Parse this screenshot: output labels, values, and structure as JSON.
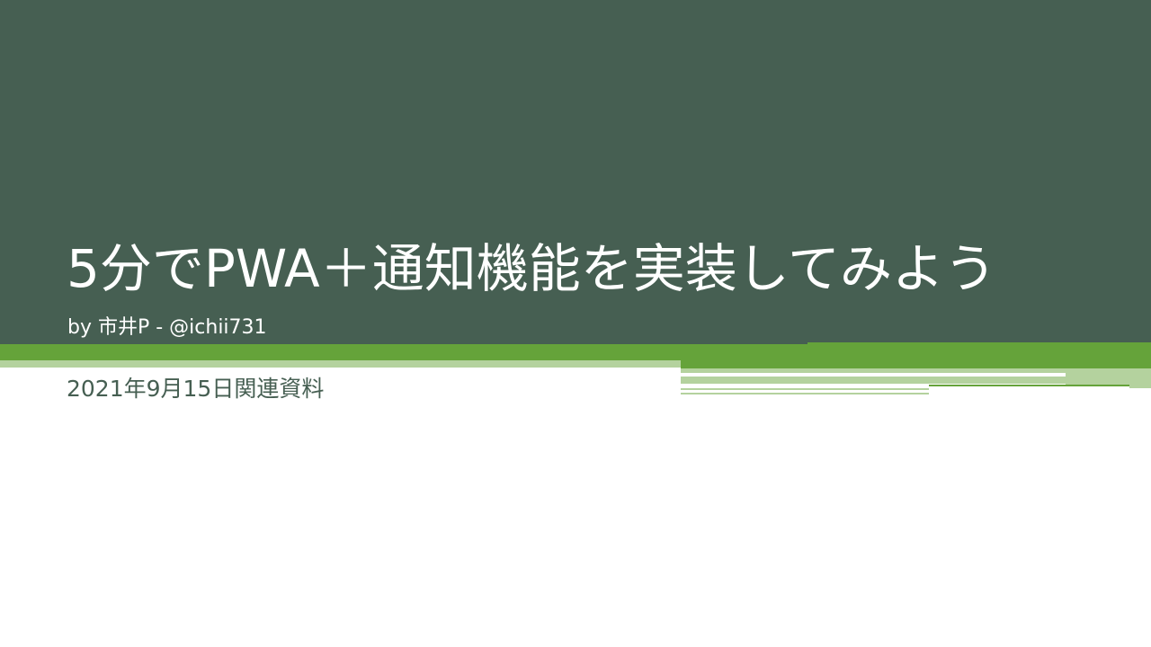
{
  "slide": {
    "title": "5分でPWA＋通知機能を実装してみよう",
    "byline": "by 市井P - @ichii731",
    "subtitle": "2021年9月15日関連資料"
  },
  "colors": {
    "band": "#465f52",
    "accent_green": "#65a33a",
    "light_green": "#b4d29e",
    "subtitle_text": "#465f52",
    "title_text": "#ffffff"
  }
}
